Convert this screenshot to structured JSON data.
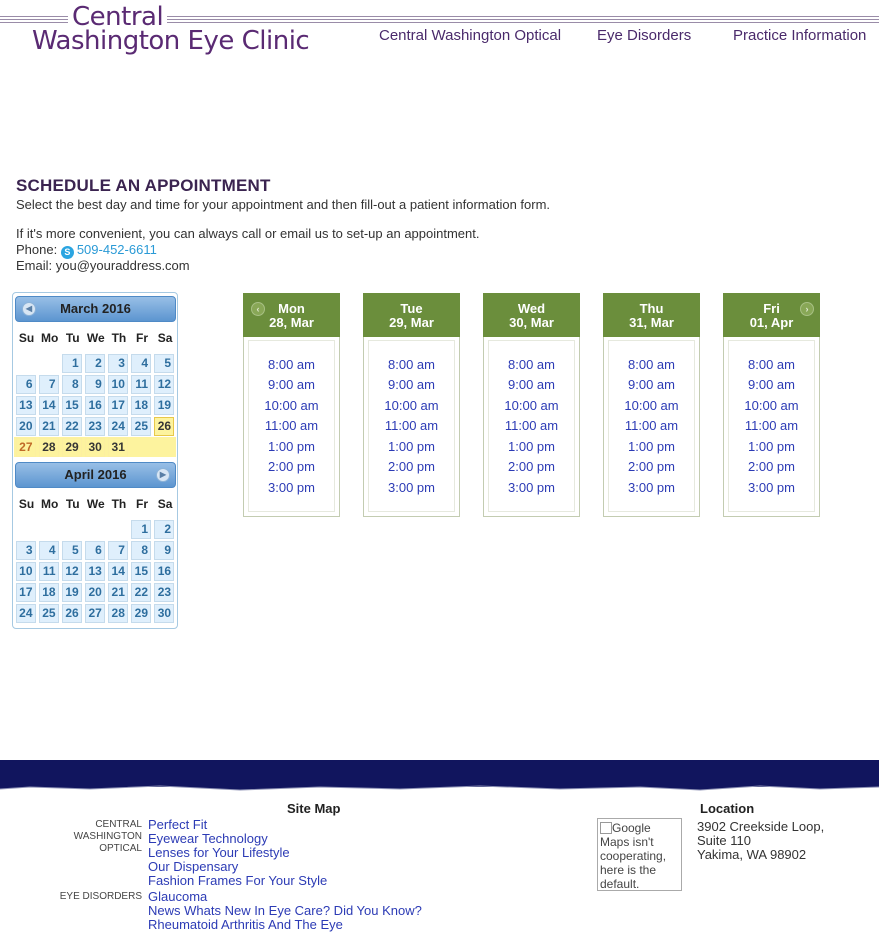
{
  "header": {
    "logo_line1": "Central",
    "logo_line2": "Washington Eye Clinic",
    "nav": [
      "Central Washington Optical",
      "Eye Disorders",
      "Practice Information"
    ]
  },
  "intro": {
    "title": "SCHEDULE AN APPOINTMENT",
    "line1": "Select the best day and time for your appointment and then fill-out a patient information form.",
    "line2": "If it's more convenient, you can always call or email us to set-up an appointment.",
    "phone_label": "Phone:",
    "phone": "509-452-6611",
    "email_label": "Email:",
    "email": "you@youraddress.com"
  },
  "calendar": {
    "weekday_headers": [
      "Su",
      "Mo",
      "Tu",
      "We",
      "Th",
      "Fr",
      "Sa"
    ],
    "month1": "March 2016",
    "month2": "April 2016",
    "march_days": [
      1,
      2,
      3,
      4,
      5,
      6,
      7,
      8,
      9,
      10,
      11,
      12,
      13,
      14,
      15,
      16,
      17,
      18,
      19,
      20,
      21,
      22,
      23,
      24,
      25,
      26,
      27,
      28,
      29,
      30,
      31
    ],
    "april_days": [
      1,
      2,
      3,
      4,
      5,
      6,
      7,
      8,
      9,
      10,
      11,
      12,
      13,
      14,
      15,
      16,
      17,
      18,
      19,
      20,
      21,
      22,
      23,
      24,
      25,
      26,
      27,
      28,
      29,
      30
    ],
    "today": 26,
    "highlighted_week": [
      27,
      28,
      29,
      30,
      31
    ]
  },
  "schedule": {
    "days": [
      {
        "weekday": "Mon",
        "date": "28, Mar"
      },
      {
        "weekday": "Tue",
        "date": "29, Mar"
      },
      {
        "weekday": "Wed",
        "date": "30, Mar"
      },
      {
        "weekday": "Thu",
        "date": "31, Mar"
      },
      {
        "weekday": "Fri",
        "date": "01, Apr"
      }
    ],
    "times": [
      "8:00 am",
      "9:00 am",
      "10:00 am",
      "11:00 am",
      "1:00 pm",
      "2:00 pm",
      "3:00 pm"
    ],
    "header_color": "#6b8e3c"
  },
  "footer": {
    "sitemap_title": "Site Map",
    "location_title": "Location",
    "categories": [
      {
        "name": "CENTRAL WASHINGTON OPTICAL",
        "links": [
          "Perfect Fit",
          "Eyewear Technology",
          "Lenses for Your Lifestyle",
          "Our Dispensary",
          "Fashion Frames For Your Style"
        ]
      },
      {
        "name": "EYE DISORDERS",
        "links": [
          "Glaucoma",
          "News Whats New In Eye Care? Did You Know?",
          "Rheumatoid Arthritis And The Eye"
        ]
      }
    ],
    "map_alt": "Google Maps isn't cooperating, here is the default.",
    "address": [
      "3902 Creekside Loop,",
      "Suite 110",
      "Yakima, WA 98902"
    ],
    "band_color": "#11155e"
  }
}
